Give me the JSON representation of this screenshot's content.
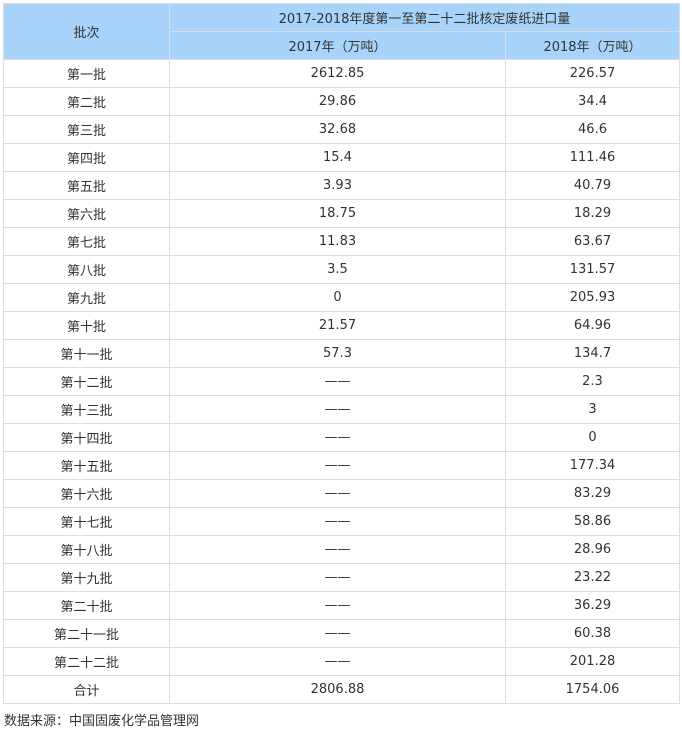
{
  "table": {
    "header": {
      "batch_label": "批次",
      "group_title": "2017-2018年度第一至第二十二批核定废纸进口量",
      "col_2017": "2017年（万吨）",
      "col_2018": "2018年（万吨）"
    },
    "rows": [
      {
        "batch": "第一批",
        "v2017": "2612.85",
        "v2018": "226.57"
      },
      {
        "batch": "第二批",
        "v2017": "29.86",
        "v2018": "34.4"
      },
      {
        "batch": "第三批",
        "v2017": "32.68",
        "v2018": "46.6"
      },
      {
        "batch": "第四批",
        "v2017": "15.4",
        "v2018": "111.46"
      },
      {
        "batch": "第五批",
        "v2017": "3.93",
        "v2018": "40.79"
      },
      {
        "batch": "第六批",
        "v2017": "18.75",
        "v2018": "18.29"
      },
      {
        "batch": "第七批",
        "v2017": "11.83",
        "v2018": "63.67"
      },
      {
        "batch": "第八批",
        "v2017": "3.5",
        "v2018": "131.57"
      },
      {
        "batch": "第九批",
        "v2017": "0",
        "v2018": "205.93"
      },
      {
        "batch": "第十批",
        "v2017": "21.57",
        "v2018": "64.96"
      },
      {
        "batch": "第十一批",
        "v2017": "57.3",
        "v2018": "134.7"
      },
      {
        "batch": "第十二批",
        "v2017": "——",
        "v2018": "2.3"
      },
      {
        "batch": "第十三批",
        "v2017": "——",
        "v2018": "3"
      },
      {
        "batch": "第十四批",
        "v2017": "——",
        "v2018": "0"
      },
      {
        "batch": "第十五批",
        "v2017": "——",
        "v2018": "177.34"
      },
      {
        "batch": "第十六批",
        "v2017": "——",
        "v2018": "83.29"
      },
      {
        "batch": "第十七批",
        "v2017": "——",
        "v2018": "58.86"
      },
      {
        "batch": "第十八批",
        "v2017": "——",
        "v2018": "28.96"
      },
      {
        "batch": "第十九批",
        "v2017": "——",
        "v2018": "23.22"
      },
      {
        "batch": "第二十批",
        "v2017": "——",
        "v2018": "36.29"
      },
      {
        "batch": "第二十一批",
        "v2017": "——",
        "v2018": "60.38"
      },
      {
        "batch": "第二十二批",
        "v2017": "——",
        "v2018": "201.28"
      },
      {
        "batch": "合计",
        "v2017": "2806.88",
        "v2018": "1754.06"
      }
    ]
  },
  "source_note": "数据来源：中国固废化学品管理网"
}
